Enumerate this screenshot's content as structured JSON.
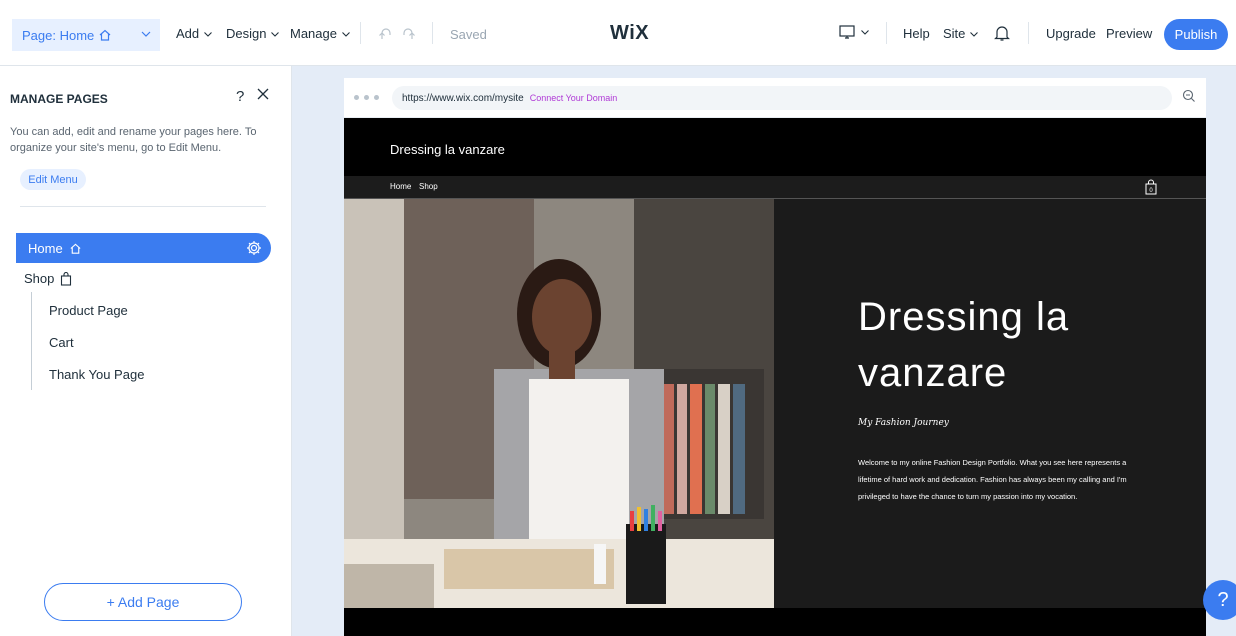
{
  "topbar": {
    "page_select": "Page: Home",
    "add": "Add",
    "design": "Design",
    "manage": "Manage",
    "saved": "Saved",
    "logo": "WiX",
    "help": "Help",
    "site": "Site",
    "upgrade": "Upgrade",
    "preview": "Preview",
    "publish": "Publish"
  },
  "panel": {
    "title": "MANAGE PAGES",
    "help": "?",
    "description": "You can add, edit and rename your pages here. To organize your site's menu, go to Edit Menu.",
    "edit_menu": "Edit Menu",
    "pages": [
      {
        "label": "Home"
      },
      {
        "label": "Shop"
      }
    ],
    "sub_pages": [
      {
        "label": "Product Page"
      },
      {
        "label": "Cart"
      },
      {
        "label": "Thank You Page"
      }
    ],
    "add_page": "+ Add Page"
  },
  "browser": {
    "url": "https://www.wix.com/mysite",
    "connect_domain": "Connect Your Domain"
  },
  "site": {
    "title": "Dressing la vanzare",
    "nav": [
      "Home",
      "Shop"
    ],
    "hero_title": "Dressing la vanzare",
    "hero_subtitle": "My Fashion Journey",
    "hero_body": "Welcome to my online Fashion Design Portfolio. What you see here represents a lifetime of hard work and dedication. Fashion has always been my calling and I'm privileged to have the chance to turn my passion into my vocation."
  },
  "help_fab": "?",
  "colors": {
    "accent": "#3b7cf0",
    "accent_light": "#e7f0ff",
    "canvas_bg": "#e4ecf7",
    "connect_domain": "#b03ad6"
  }
}
